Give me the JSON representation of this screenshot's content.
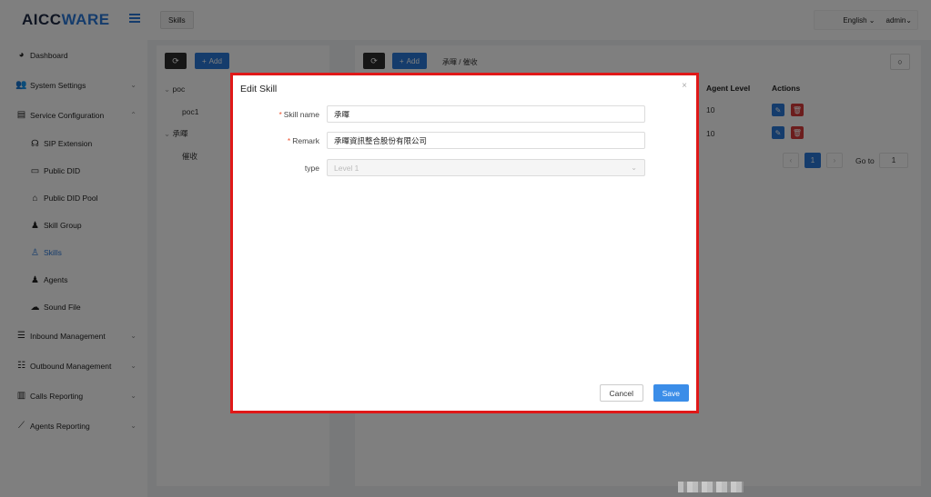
{
  "app": {
    "logo_main": "AICC",
    "logo_accent": "WARE"
  },
  "header": {
    "tab_label": "Skills",
    "language": "English",
    "user": "admin"
  },
  "sidebar": {
    "items": [
      {
        "label": "Dashboard",
        "icon": "dashboard-icon",
        "chevron": false
      },
      {
        "label": "System Settings",
        "icon": "users-icon",
        "chevron": true
      },
      {
        "label": "Service Configuration",
        "icon": "id-card-icon",
        "chevron": true,
        "expanded": true
      }
    ],
    "sub_items": [
      {
        "label": "SIP Extension",
        "icon": "headset-icon"
      },
      {
        "label": "Public DID",
        "icon": "folder-icon"
      },
      {
        "label": "Public DID Pool",
        "icon": "home-icon"
      },
      {
        "label": "Skill Group",
        "icon": "user-icon"
      },
      {
        "label": "Skills",
        "icon": "user-outline-icon",
        "active": true
      },
      {
        "label": "Agents",
        "icon": "user-icon"
      },
      {
        "label": "Sound File",
        "icon": "cloud-icon"
      }
    ],
    "bottom_items": [
      {
        "label": "Inbound Management",
        "icon": "list-icon"
      },
      {
        "label": "Outbound Management",
        "icon": "grid-list-icon"
      },
      {
        "label": "Calls Reporting",
        "icon": "bar-chart-icon"
      },
      {
        "label": "Agents Reporting",
        "icon": "line-chart-icon"
      }
    ]
  },
  "left_panel": {
    "refresh_icon": "refresh-icon",
    "add_label": "Add",
    "tree": [
      {
        "label": "poc",
        "type": "group"
      },
      {
        "label": "poc1",
        "type": "leaf"
      },
      {
        "label": "承暉",
        "type": "group"
      },
      {
        "label": "催收",
        "type": "leaf"
      }
    ]
  },
  "right_panel": {
    "add_label": "Add",
    "breadcrumb": "承暉 / 催收",
    "columns": {
      "agent_level": "Agent Level",
      "actions": "Actions"
    },
    "rows": [
      {
        "agent_level": "10"
      },
      {
        "agent_level": "10"
      }
    ],
    "pager": {
      "current": "1",
      "goto_label": "Go to",
      "goto_value": "1"
    }
  },
  "modal": {
    "title": "Edit Skill",
    "close": "×",
    "fields": {
      "skill_name": {
        "label": "Skill name",
        "value": "承暉",
        "required": true
      },
      "remark": {
        "label": "Remark",
        "value": "承暉資訊整合股份有限公司",
        "required": true
      },
      "type": {
        "label": "type",
        "value": "Level 1",
        "required": false
      }
    },
    "cancel_label": "Cancel",
    "save_label": "Save"
  }
}
